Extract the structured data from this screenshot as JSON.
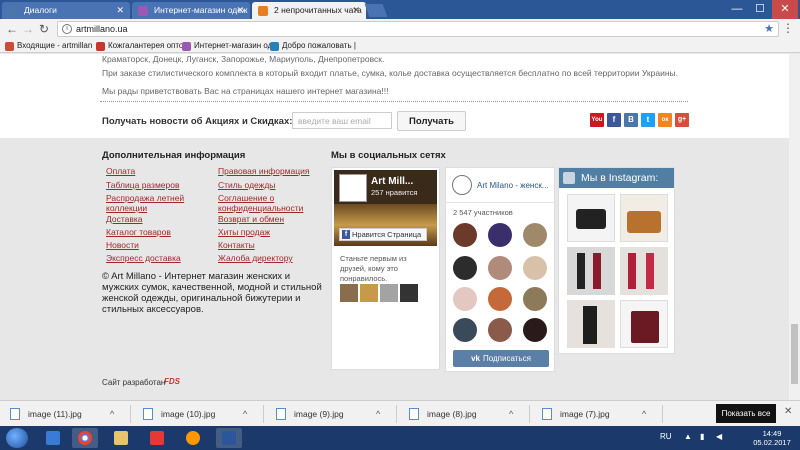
{
  "tabs": [
    {
      "label": "Диалоги",
      "icon": "vk-icon",
      "color": "#4a76a8"
    },
    {
      "label": "Интернет-магазин одеж",
      "icon": "art-millano-icon",
      "color": "#9b59b6"
    },
    {
      "label": "2 непрочитанных чата",
      "icon": "mail-icon",
      "color": "#e67e22"
    }
  ],
  "window_controls": {
    "minimize": "—",
    "maximize": "☐",
    "close": "✕"
  },
  "nav": {
    "back": "←",
    "forward": "→",
    "reload": "↻",
    "menu": "⋮"
  },
  "address": {
    "url": "artmillano.ua",
    "info": "i",
    "star": "★"
  },
  "bookmarks": [
    {
      "label": "Входящие - artmillan",
      "color": "#d14836"
    },
    {
      "label": "Кожгалантерея оптом",
      "color": "#c0392b"
    },
    {
      "label": "Интернет-магазин од",
      "color": "#9b59b6"
    },
    {
      "label": "Добро пожаловать |",
      "color": "#2980b9"
    }
  ],
  "content": {
    "cities_line": "Краматорск, Донецк, Луганск, Запорожье, Мариуполь, Днепропетровск.",
    "delivery_line": "При заказе стилистического комплекта в который входит платье, сумка, колье доставка осуществляется бесплатно по всей территории Украины.",
    "welcome_line": "Мы рады приветствовать Вас на страницах нашего интернет магазина!!!"
  },
  "newsletter": {
    "label": "Получать новости об Акциях и Скидках:",
    "placeholder": "введите ваш email",
    "button": "Получать"
  },
  "social_icons": [
    {
      "name": "youtube-icon",
      "glyph": "You",
      "color": "#cc181e"
    },
    {
      "name": "facebook-icon",
      "glyph": "f",
      "color": "#3b5998"
    },
    {
      "name": "vk-icon",
      "glyph": "B",
      "color": "#4a76a8"
    },
    {
      "name": "twitter-icon",
      "glyph": "t",
      "color": "#1da1f2"
    },
    {
      "name": "odnoklassniki-icon",
      "glyph": "ок",
      "color": "#f48420"
    },
    {
      "name": "google-plus-icon",
      "glyph": "g+",
      "color": "#dd4b39"
    }
  ],
  "info": {
    "title": "Дополнительная информация",
    "left_links": [
      "Оплата",
      "Таблица размеров",
      "Распродажа летней коллекции",
      "Доставка",
      "Каталог товаров",
      "Новости",
      "Экспресс доставка"
    ],
    "right_links": [
      "Правовая информация",
      "Стиль одежды",
      "Соглашение о конфиденциальности",
      "Возврат и обмен",
      "Хиты продаж",
      "Контакты",
      "Жалоба директору"
    ]
  },
  "copyright": "© Art Millano - Интернет магазин женских и мужских сумок, качественной, модной и стильной женской одежды, оригинальной бижутерии и стильных аксессуаров.",
  "developer": {
    "label": "Сайт разработан",
    "logo": "FDS"
  },
  "social": {
    "title": "Мы в социальных сетях",
    "facebook": {
      "name": "Art Mill...",
      "likes": "257 нравится",
      "like_button": "Нравится Страница",
      "prompt": "Станьте первым из друзей, кому это понравилось."
    },
    "vk": {
      "name": "Art Milano - женск...",
      "members": "2 547 участников",
      "subscribe": "Подписаться",
      "subscribe_icon": "vk"
    },
    "instagram": {
      "title": "Мы в Instagram:"
    }
  },
  "downloads": [
    {
      "file": "image (11).jpg"
    },
    {
      "file": "image (10).jpg"
    },
    {
      "file": "image (9).jpg"
    },
    {
      "file": "image (8).jpg"
    },
    {
      "file": "image (7).jpg"
    }
  ],
  "downloads_show_all": "Показать все",
  "taskbar": {
    "language": "RU",
    "time": "14:49",
    "date": "05.02.2017"
  }
}
